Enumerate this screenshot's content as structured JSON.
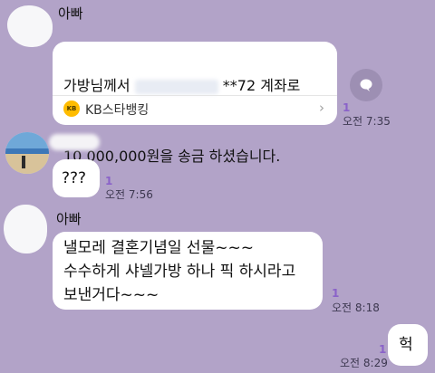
{
  "chat": {
    "messages": [
      {
        "sender": "아빠",
        "text_prefix": "가방님께서 ",
        "text_suffix": " **72 계좌로",
        "text_line2": "10,000,000원을 송금 하셨습니다.",
        "bank_label": "KB스타뱅킹",
        "bank_logo_text": "KB",
        "read_count": "1",
        "time": "오전 7:35",
        "share_icon": "speech-bubble-icon"
      },
      {
        "text": "???",
        "read_count": "1",
        "time": "오전 7:56"
      },
      {
        "sender": "아빠",
        "text": "낼모레 결혼기념일 선물~~~\n수수하게 샤넬가방 하나 픽 하시라고\n보낸거다~~~",
        "read_count": "1",
        "time": "오전 8:18"
      },
      {
        "text": "헉",
        "read_count": "1",
        "time": "오전 8:29",
        "own": true
      }
    ]
  },
  "colors": {
    "background": "#b2a3c8",
    "bubble_other": "#ffffff",
    "bubble_own": "#ffffff",
    "read_count": "#8a62c9",
    "bank_logo": "#ffbc00"
  }
}
